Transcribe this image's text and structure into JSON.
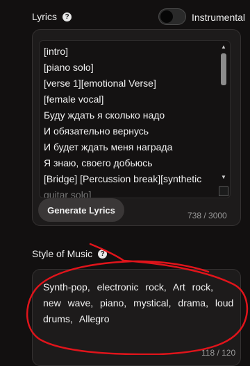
{
  "lyrics_section": {
    "label": "Lyrics",
    "help_icon": "help-icon",
    "instrumental_label": "Instrumental",
    "instrumental_on": false,
    "lines": [
      "[intro]",
      "[piano solo]",
      "[verse 1][emotional Verse]",
      "[female vocal]",
      "Буду ждать я сколько надо",
      "И обязательно вернусь",
      "И будет ждать меня награда",
      "Я знаю, своего добьюсь",
      "[Bridge] [Percussion break][synthetic",
      "guitar solo]"
    ],
    "generate_button": "Generate Lyrics",
    "char_count": "738 / 3000"
  },
  "style_section": {
    "label": "Style of Music",
    "help_icon": "help-icon",
    "tags_text": "Synth-pop, electronic rock, Art rock, new wave, piano, mystical, drama, loud drums, Allegro",
    "char_count": "118 / 120"
  },
  "annotation_color": "#e0141b"
}
